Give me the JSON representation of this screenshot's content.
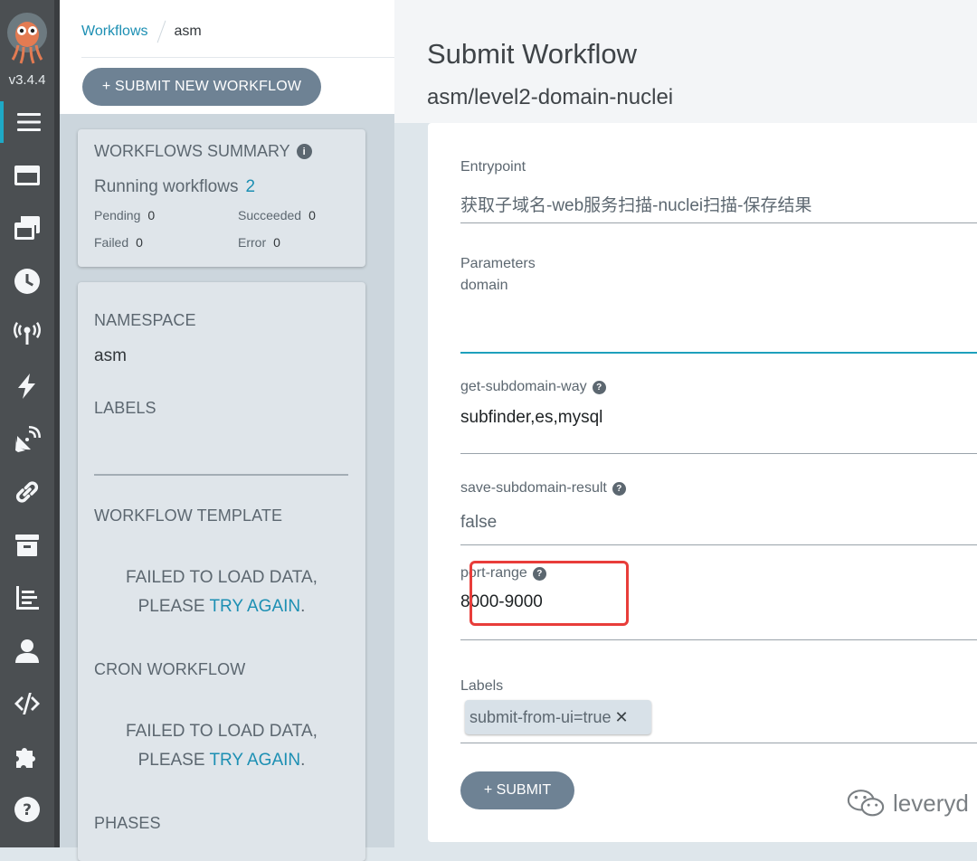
{
  "app": {
    "version": "v3.4.4"
  },
  "nav": {
    "items": [
      {
        "icon": "hamburger-icon",
        "active": true
      },
      {
        "icon": "window-icon"
      },
      {
        "icon": "stacked-windows-icon"
      },
      {
        "icon": "clock-icon"
      },
      {
        "icon": "antenna-icon"
      },
      {
        "icon": "lightning-icon"
      },
      {
        "icon": "satellite-dish-icon"
      },
      {
        "icon": "link-icon"
      },
      {
        "icon": "archive-box-icon"
      },
      {
        "icon": "chart-icon"
      },
      {
        "icon": "user-icon"
      },
      {
        "icon": "code-icon"
      },
      {
        "icon": "puzzle-icon"
      },
      {
        "icon": "help-icon"
      }
    ]
  },
  "breadcrumb": {
    "root": "Workflows",
    "current": "asm"
  },
  "toolbar": {
    "submit_new_label": "+ SUBMIT NEW WORKFLOW"
  },
  "summary": {
    "title": "WORKFLOWS SUMMARY",
    "running_label": "Running workflows",
    "running_count": "2",
    "pending_label": "Pending",
    "pending_count": "0",
    "succeeded_label": "Succeeded",
    "succeeded_count": "0",
    "failed_label": "Failed",
    "failed_count": "0",
    "error_label": "Error",
    "error_count": "0"
  },
  "details": {
    "namespace_heading": "NAMESPACE",
    "namespace_value": "asm",
    "labels_heading": "LABELS",
    "template_heading": "WORKFLOW TEMPLATE",
    "template_fail_line1": "FAILED TO LOAD DATA,",
    "template_fail_line2": "PLEASE ",
    "template_fail_try": "TRY AGAIN",
    "template_fail_dot": ".",
    "cron_heading": "CRON WORKFLOW",
    "cron_fail_line1": "FAILED TO LOAD DATA,",
    "cron_fail_line2": "PLEASE ",
    "cron_fail_try": "TRY AGAIN",
    "cron_fail_dot": ".",
    "phases_heading": "PHASES"
  },
  "main": {
    "title": "Submit Workflow",
    "subtitle": "asm/level2-domain-nuclei"
  },
  "form": {
    "entrypoint_label": "Entrypoint",
    "entrypoint_value": "获取子域名-web服务扫描-nuclei扫描-保存结果",
    "parameters_label": "Parameters",
    "domain_label": "domain",
    "domain_value": "",
    "subdomain_way_label": "get-subdomain-way",
    "subdomain_way_value": "subfinder,es,mysql",
    "save_result_label": "save-subdomain-result",
    "save_result_value": "false",
    "port_range_label": "port-range",
    "port_range_value": "8000-9000",
    "labels_label": "Labels",
    "label_chip": "submit-from-ui=true",
    "chip_remove": "✕",
    "submit_label": "+ SUBMIT"
  },
  "watermark": {
    "text": "leveryd"
  },
  "colors": {
    "accent": "#1c8fb3",
    "highlight": "#e83d3a",
    "nav_bg": "#4b4f52"
  }
}
